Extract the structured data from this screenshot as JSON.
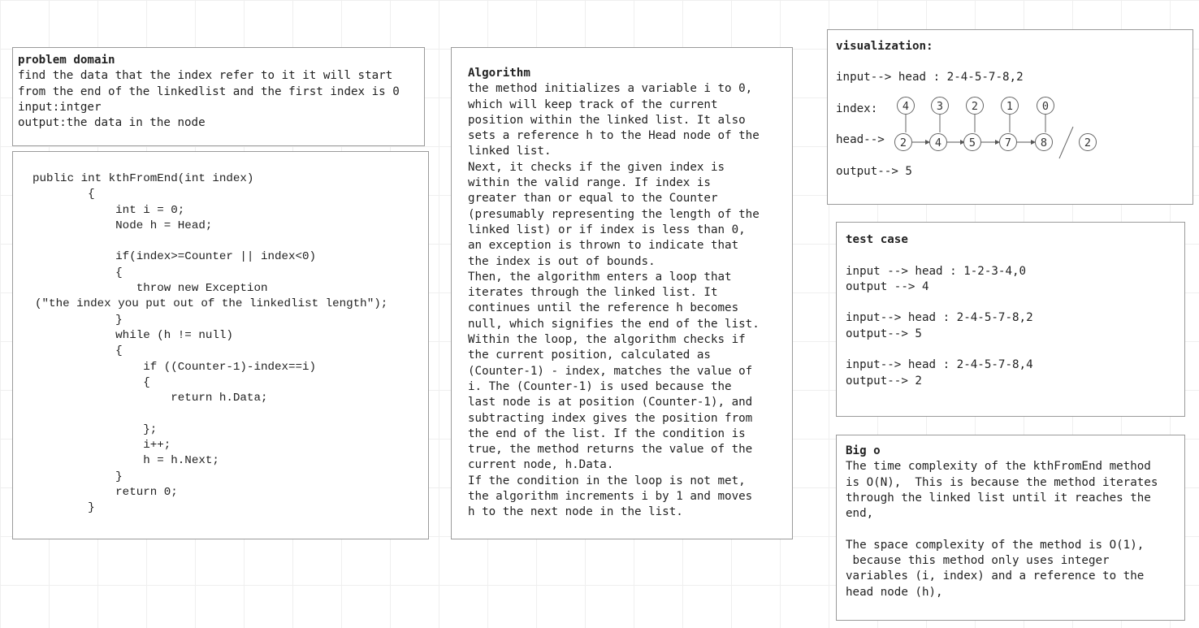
{
  "problem": {
    "title": "problem domain",
    "lines": [
      "find the data that the index refer to it it will start",
      "from the end of the linkedlist and the first index is 0",
      "input:intger",
      "output:the data in the node"
    ]
  },
  "code": {
    "lines": [
      "public int kthFromEnd(int index)",
      "        {",
      "            int i = 0;",
      "            Node h = Head;",
      "",
      "            if(index>=Counter || index<0)",
      "            {",
      "               throw new Exception",
      "  (\"the index you put out of the linkedlist length\");",
      "            }",
      "            while (h != null)",
      "            {",
      "                if ((Counter-1)-index==i)",
      "                {",
      "                    return h.Data;",
      "",
      "                };",
      "                i++;",
      "                h = h.Next;",
      "            }",
      "            return 0;",
      "        }"
    ]
  },
  "algorithm": {
    "title": "Algorithm",
    "lines": [
      "the method initializes a variable i to 0,",
      "which will keep track of the current",
      "position within the linked list. It also",
      "sets a reference h to the Head node of the",
      "linked list.",
      "Next, it checks if the given index is",
      "within the valid range. If index is",
      "greater than or equal to the Counter",
      "(presumably representing the length of the",
      "linked list) or if index is less than 0,",
      "an exception is thrown to indicate that",
      "the index is out of bounds.",
      "Then, the algorithm enters a loop that",
      "iterates through the linked list. It",
      "continues until the reference h becomes",
      "null, which signifies the end of the list.",
      "Within the loop, the algorithm checks if",
      "the current position, calculated as",
      "(Counter-1) - index, matches the value of",
      "i. The (Counter-1) is used because the",
      "last node is at position (Counter-1), and",
      "subtracting index gives the position from",
      "the end of the list. If the condition is",
      "true, the method returns the value of the",
      "current node, h.Data.",
      "If the condition in the loop is not met,",
      "the algorithm increments i by 1 and moves",
      "h to the next node in the list."
    ]
  },
  "visualization": {
    "title": "visualization:",
    "input_line": "input--> head : 2-4-5-7-8,2",
    "index_label": "index:",
    "head_label": "head-->",
    "output_line": "output--> 5",
    "index_values": [
      "4",
      "3",
      "2",
      "1",
      "0"
    ],
    "node_values": [
      "2",
      "4",
      "5",
      "7",
      "8"
    ],
    "k_value": "2"
  },
  "test_case": {
    "title": "test case",
    "lines": [
      "input --> head : 1-2-3-4,0",
      "output --> 4",
      "",
      "input--> head : 2-4-5-7-8,2",
      "output--> 5",
      "",
      "input--> head : 2-4-5-7-8,4",
      "output--> 2"
    ]
  },
  "big_o": {
    "title": "Big o",
    "lines": [
      "The time complexity of the kthFromEnd method",
      "is O(N),  This is because the method iterates",
      "through the linked list until it reaches the",
      "end,",
      "",
      "The space complexity of the method is O(1),",
      " because this method only uses integer",
      "variables (i, index) and a reference to the",
      "head node (h),"
    ]
  }
}
